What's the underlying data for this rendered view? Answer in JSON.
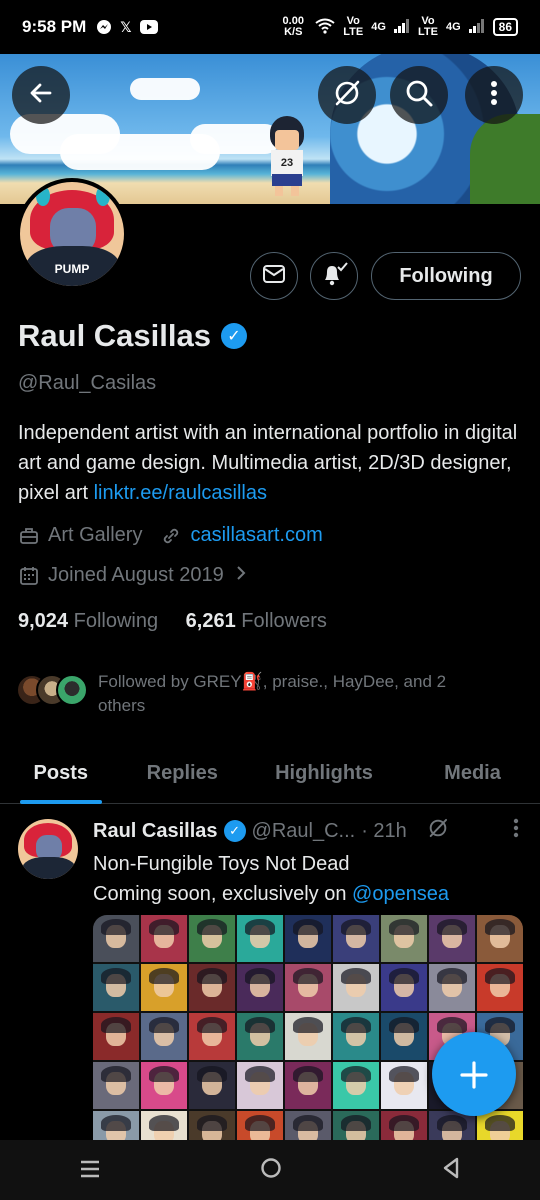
{
  "status_bar": {
    "time": "9:58 PM",
    "apps": [
      "messenger-icon",
      "x-icon",
      "youtube-icon"
    ],
    "net_speed": "0.00 K/S",
    "sig1": "Vo LTE",
    "net1": "4G",
    "sig2": "Vo LTE",
    "net2": "4G",
    "battery": "86"
  },
  "banner": {
    "shirt_number": "23"
  },
  "profile": {
    "avatar_text": "PUMP",
    "name": "Raul Casillas",
    "handle": "@Raul_Casilas",
    "bio": "Independent artist with an international portfolio in digital art and game design. Multimedia artist, 2D/3D designer, pixel art ",
    "bio_link": "linktr.ee/raulcasillas",
    "category": "Art Gallery",
    "website": "casillasart.com",
    "joined": "Joined August 2019",
    "following_count": "9,024",
    "following_label": "Following",
    "followers_count": "6,261",
    "followers_label": "Followers",
    "followed_by_line1": "Followed by GREY⛽, praise., HayDee, and 2",
    "followed_by_line2": "others"
  },
  "actions": {
    "following_button": "Following"
  },
  "tabs": [
    {
      "label": "Posts",
      "active": true
    },
    {
      "label": "Replies"
    },
    {
      "label": "Highlights"
    },
    {
      "label": "Media"
    }
  ],
  "post": {
    "name": "Raul Casillas",
    "handle": "@Raul_C...",
    "time": "· 21h",
    "line1": "Non-Fungible Toys Not Dead",
    "line2_prefix": "Coming soon, exclusively on ",
    "mention": "@opensea"
  },
  "colors": {
    "accent": "#1d9bf0",
    "background": "#000000",
    "muted": "#71767b"
  }
}
